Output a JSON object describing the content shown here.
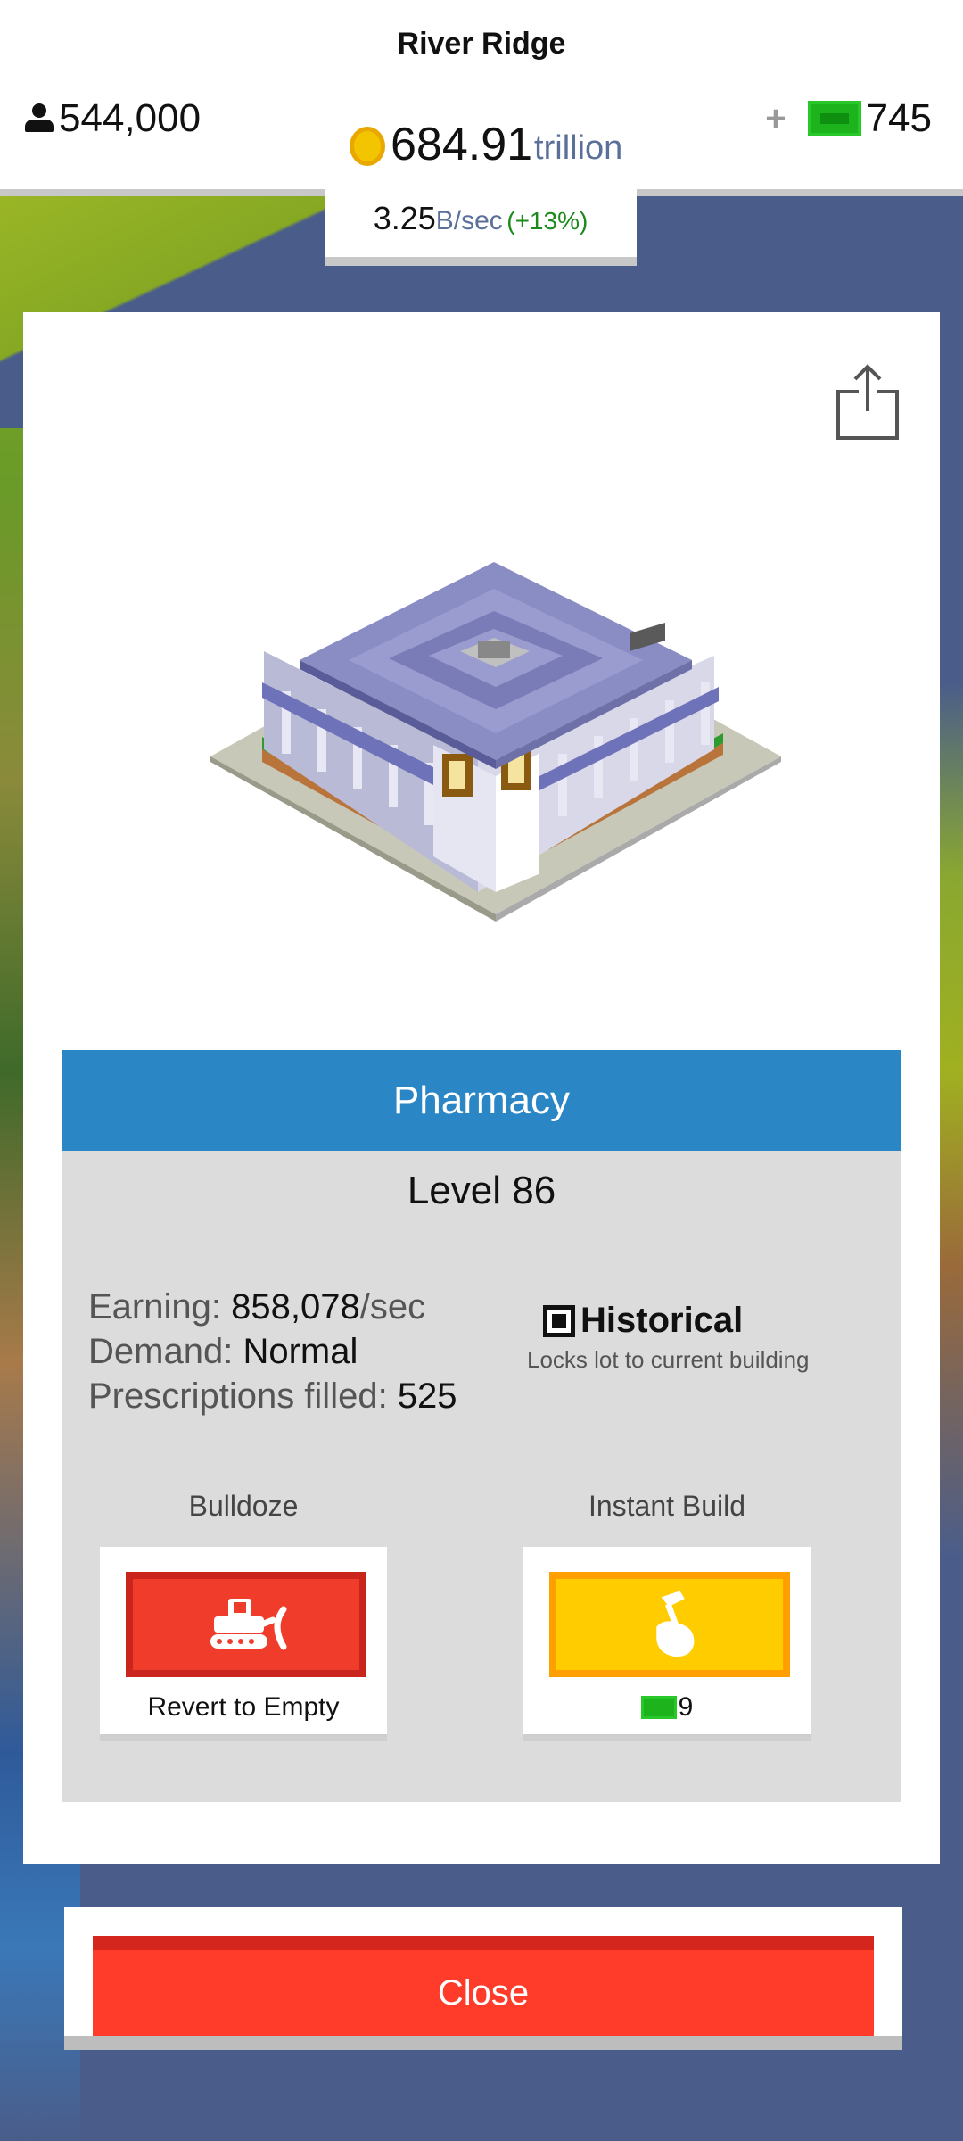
{
  "header": {
    "city_name": "River Ridge",
    "population": "544,000",
    "money_value": "684.91",
    "money_unit": "trillion",
    "cash_plus": "+",
    "cash_count": "745",
    "rate_value": "3.25",
    "rate_unit": "B/sec",
    "rate_change": "(+13%)"
  },
  "building": {
    "name": "Pharmacy",
    "level": "Level 86",
    "earning_label": "Earning:",
    "earning_value": "858,078",
    "earning_unit": "/sec",
    "demand_label": "Demand:",
    "demand_value": "Normal",
    "stat_label": "Prescriptions filled:",
    "stat_value": "525",
    "historical_label": "Historical",
    "historical_checked": true,
    "historical_desc": "Locks lot to current building"
  },
  "actions": {
    "bulldoze_label": "Bulldoze",
    "bulldoze_caption": "Revert to Empty",
    "instant_label": "Instant Build",
    "instant_cost": "9"
  },
  "close_label": "Close",
  "colors": {
    "title_bar": "#2b86c5",
    "bulldoze": "#f03c2a",
    "instant": "#ffcc00",
    "close": "#ff3b2a",
    "cash_green": "#1db31d"
  }
}
